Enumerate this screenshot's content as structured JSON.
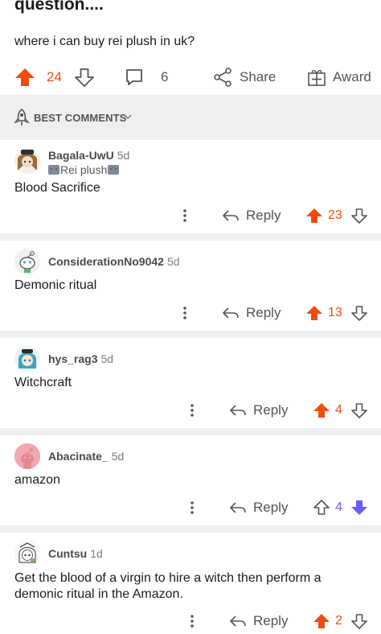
{
  "post": {
    "title": "question....",
    "body": "where i can buy rei plush in uk?",
    "score": "24",
    "comments_count": "6",
    "share_label": "Share",
    "award_label": "Award"
  },
  "sort": {
    "label": "BEST COMMENTS"
  },
  "comments": [
    {
      "username": "Bagala-UwU",
      "age": "5d",
      "flair": "Rei plush",
      "text": "Blood Sacrifice",
      "reply_label": "Reply",
      "score": "23",
      "vote": "up"
    },
    {
      "username": "ConsiderationNo9042",
      "age": "5d",
      "text": "Demonic ritual",
      "reply_label": "Reply",
      "score": "13",
      "vote": "up"
    },
    {
      "username": "hys_rag3",
      "age": "5d",
      "text": "Witchcraft",
      "reply_label": "Reply",
      "score": "4",
      "vote": "up"
    },
    {
      "username": "Abacinate_",
      "age": "5d",
      "text": "amazon",
      "reply_label": "Reply",
      "score": "4",
      "vote": "down"
    },
    {
      "username": "Cuntsu",
      "age": "1d",
      "text": "Get the blood of a virgin to hire a witch then perform a demonic ritual in the Amazon.",
      "reply_label": "Reply",
      "score": "2",
      "vote": "up"
    }
  ],
  "colors": {
    "upvote": "#f04d0c",
    "downvote": "#6a5cff",
    "divider": "#edeff1",
    "muted": "#555555"
  }
}
